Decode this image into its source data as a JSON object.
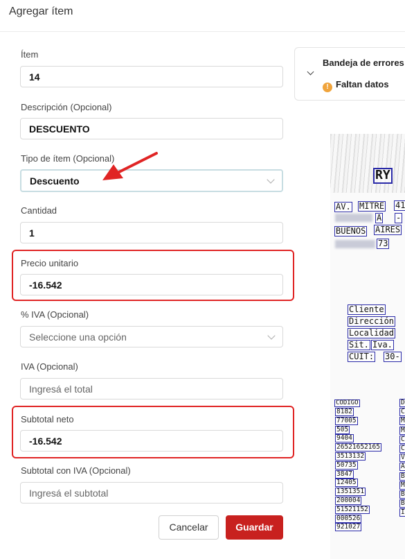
{
  "header": {
    "title": "Agregar ítem"
  },
  "form": {
    "item": {
      "label": "Ítem",
      "value": "14"
    },
    "descripcion": {
      "label": "Descripción (Opcional)",
      "value": "DESCUENTO"
    },
    "tipo": {
      "label": "Tipo de ítem (Opcional)",
      "value": "Descuento"
    },
    "cantidad": {
      "label": "Cantidad",
      "value": "1"
    },
    "precio": {
      "label": "Precio unitario",
      "value": "-16.542"
    },
    "iva_pct": {
      "label": "% IVA (Opcional)",
      "placeholder": "Seleccione una opción"
    },
    "iva": {
      "label": "IVA (Opcional)",
      "placeholder": "Ingresá el total"
    },
    "subtotal_neto": {
      "label": "Subtotal neto",
      "value": "-16.542"
    },
    "subtotal_iva": {
      "label": "Subtotal con IVA (Opcional)",
      "placeholder": "Ingresá el subtotal"
    },
    "cancel_label": "Cancelar",
    "save_label": "Guardar"
  },
  "errors": {
    "title": "Bandeja de errores",
    "status": "Faltan datos",
    "warn_glyph": "!"
  },
  "document": {
    "header": [
      "RY",
      "AV.",
      "MITRE",
      "41",
      "A",
      "-",
      "BUENOS",
      "AIRES",
      "73"
    ],
    "client_fields": [
      "Cliente",
      "Dirección",
      "Localidad",
      "Sit.",
      "Iva.",
      "CUIT:",
      "30-"
    ],
    "codigo_header": "CODIGO",
    "codes": [
      "8182",
      "77005",
      "505",
      "9404",
      "26521652165",
      "3513132",
      "50735",
      "3847",
      "12405",
      "1351351",
      "200004",
      "51521152",
      "000526",
      "921027"
    ],
    "col2_letters": [
      "D",
      "C",
      "M",
      "M",
      "C",
      "C",
      "V",
      "A",
      "B",
      "M",
      "B",
      "B",
      "I"
    ]
  },
  "colors": {
    "primary": "#c8211f",
    "highlight": "#e02424",
    "warning": "#f0a43c",
    "ocr_box": "#2a2aa8"
  },
  "icons": {
    "dropdown": "chevron-down-icon",
    "collapse": "chevron-down-icon",
    "warning": "warning-icon",
    "annotation": "arrow-icon"
  }
}
